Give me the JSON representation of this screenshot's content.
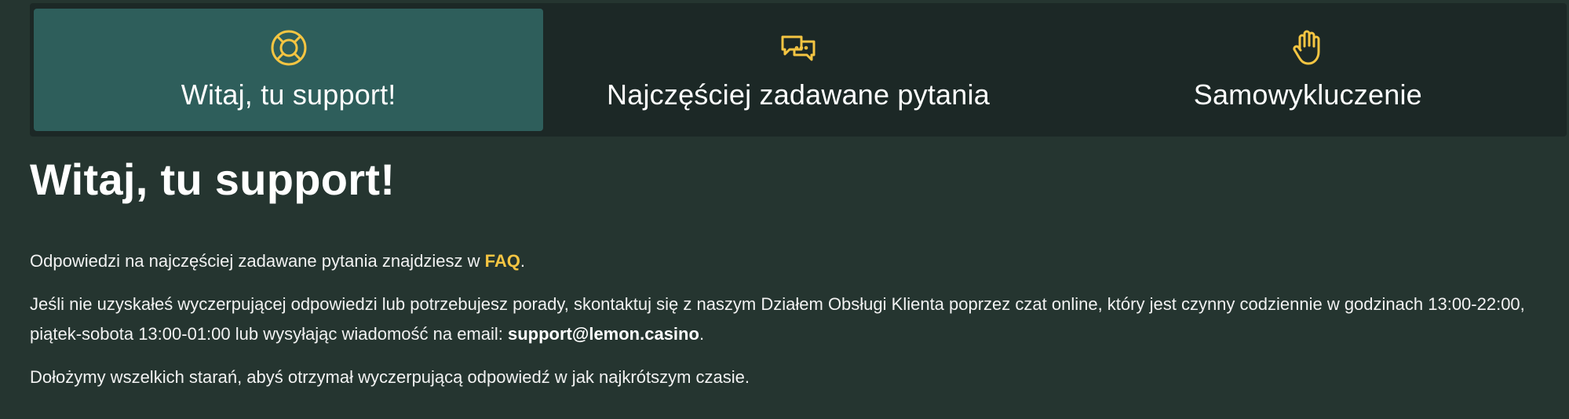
{
  "tabs": [
    {
      "label": "Witaj, tu support!",
      "icon": "lifebuoy-icon",
      "active": true
    },
    {
      "label": "Najczęściej zadawane pytania",
      "icon": "chat-bubbles-icon",
      "active": false
    },
    {
      "label": "Samowykluczenie",
      "icon": "raised-hand-icon",
      "active": false
    }
  ],
  "colors": {
    "background": "#253530",
    "tabbar": "#1c2826",
    "active_tab": "#2e5e5b",
    "accent": "#f5c542"
  },
  "main": {
    "title": "Witaj, tu support!",
    "p1_before": "Odpowiedzi na najczęściej zadawane pytania znajdziesz w ",
    "p1_link": "FAQ",
    "p1_after": ".",
    "p2_before": "Jeśli nie uzyskałeś wyczerpującej odpowiedzi lub potrzebujesz porady, skontaktuj się z naszym Działem Obsługi Klienta poprzez czat online, który jest czynny codziennie w godzinach 13:00-22:00, piątek-sobota 13:00-01:00 lub wysyłając wiadomość na email: ",
    "p2_email": "support@lemon.casino",
    "p2_after": ".",
    "p3": "Dołożymy wszelkich starań, abyś otrzymał wyczerpującą odpowiedź w jak najkrótszym czasie."
  }
}
